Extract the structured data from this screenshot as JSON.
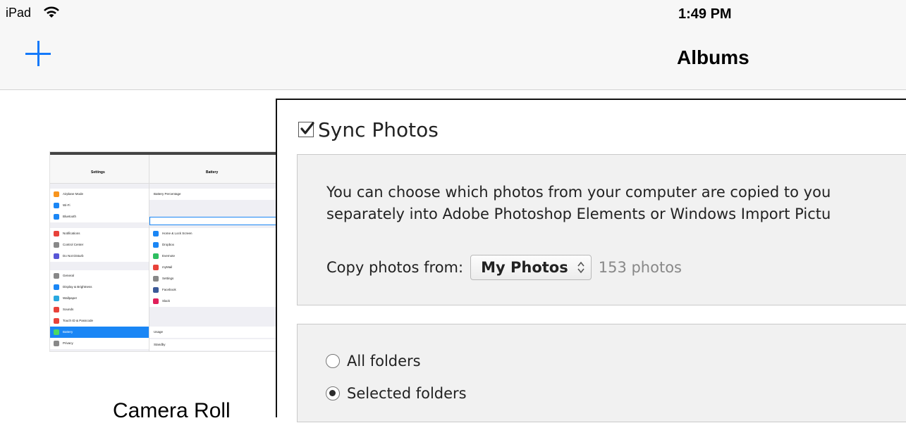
{
  "ios": {
    "carrier": "iPad",
    "time": "1:49 PM",
    "nav_title": "Albums",
    "add_icon": "plus-icon",
    "wifi_icon": "wifi-icon"
  },
  "album": {
    "label": "Camera Roll"
  },
  "itunes": {
    "sync_label": "Sync Photos",
    "sync_checked": true,
    "description_line1": "You can choose which photos from your computer are copied to you",
    "description_line2": "separately into Adobe Photoshop Elements or Windows Import Pictu",
    "copy_from_label": "Copy photos from:",
    "copy_from_value": "My Photos",
    "photo_count": "153 photos",
    "options": [
      {
        "label": "All folders",
        "selected": false
      },
      {
        "label": "Selected folders",
        "selected": true
      }
    ]
  },
  "colors": {
    "ios_blue": "#1479fa",
    "panel_bg": "#f1f1f1"
  }
}
